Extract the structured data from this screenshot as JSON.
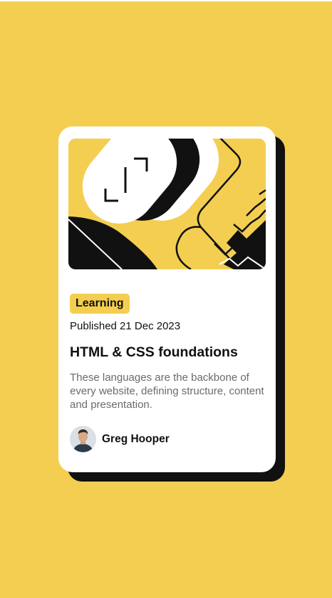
{
  "card": {
    "image_alt": "Abstract illustration",
    "category": "Learning",
    "published": "Published 21 Dec 2023",
    "title": "HTML & CSS foundations",
    "description": "These languages are the backbone of every website, defining structure, content and presentation.",
    "author": {
      "name": "Greg Hooper",
      "avatar_icon": "person-avatar"
    }
  },
  "colors": {
    "background": "#f4ce51",
    "accent": "#f4ce51",
    "card": "#ffffff",
    "shadow": "#111111",
    "text": "#111111",
    "muted_text": "#6b6b6b"
  }
}
